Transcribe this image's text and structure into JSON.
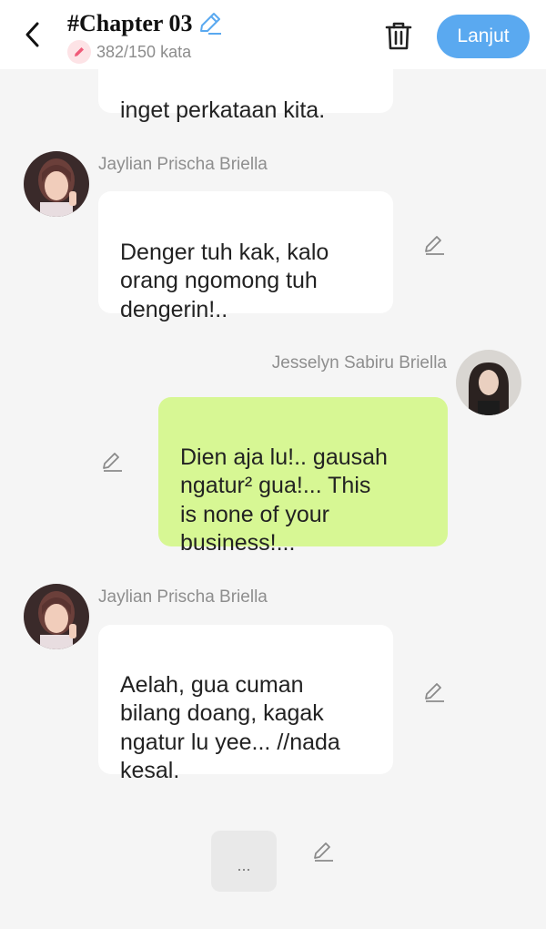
{
  "header": {
    "back_icon": "chevron-left-icon",
    "title": "#Chapter 03",
    "title_edit_icon": "pencil-icon",
    "word_count": "382/150 kata",
    "word_count_icon": "pencil-badge-icon",
    "delete_icon": "trash-icon",
    "next_label": "Lanjut",
    "accent_color": "#5aa9f0"
  },
  "messages": [
    {
      "sender": "",
      "text": "inget perkataan kita.",
      "side": "left"
    },
    {
      "sender": "Jaylian Prischa Briella",
      "text": "Denger tuh kak, kalo\norang ngomong tuh\ndengerin!..",
      "side": "left"
    },
    {
      "sender": "Jesselyn Sabiru Briella",
      "text": "Dien aja lu!.. gausah\nngatur² gua!... This\nis none of your\nbusiness!...",
      "side": "right",
      "bubble_color": "#d7f794"
    },
    {
      "sender": "Jaylian Prischa Briella",
      "text": "Aelah, gua cuman\nbilang doang, kagak\nngatur lu yee... //nada\nkesal.",
      "side": "left"
    }
  ],
  "typing_indicator": "..."
}
